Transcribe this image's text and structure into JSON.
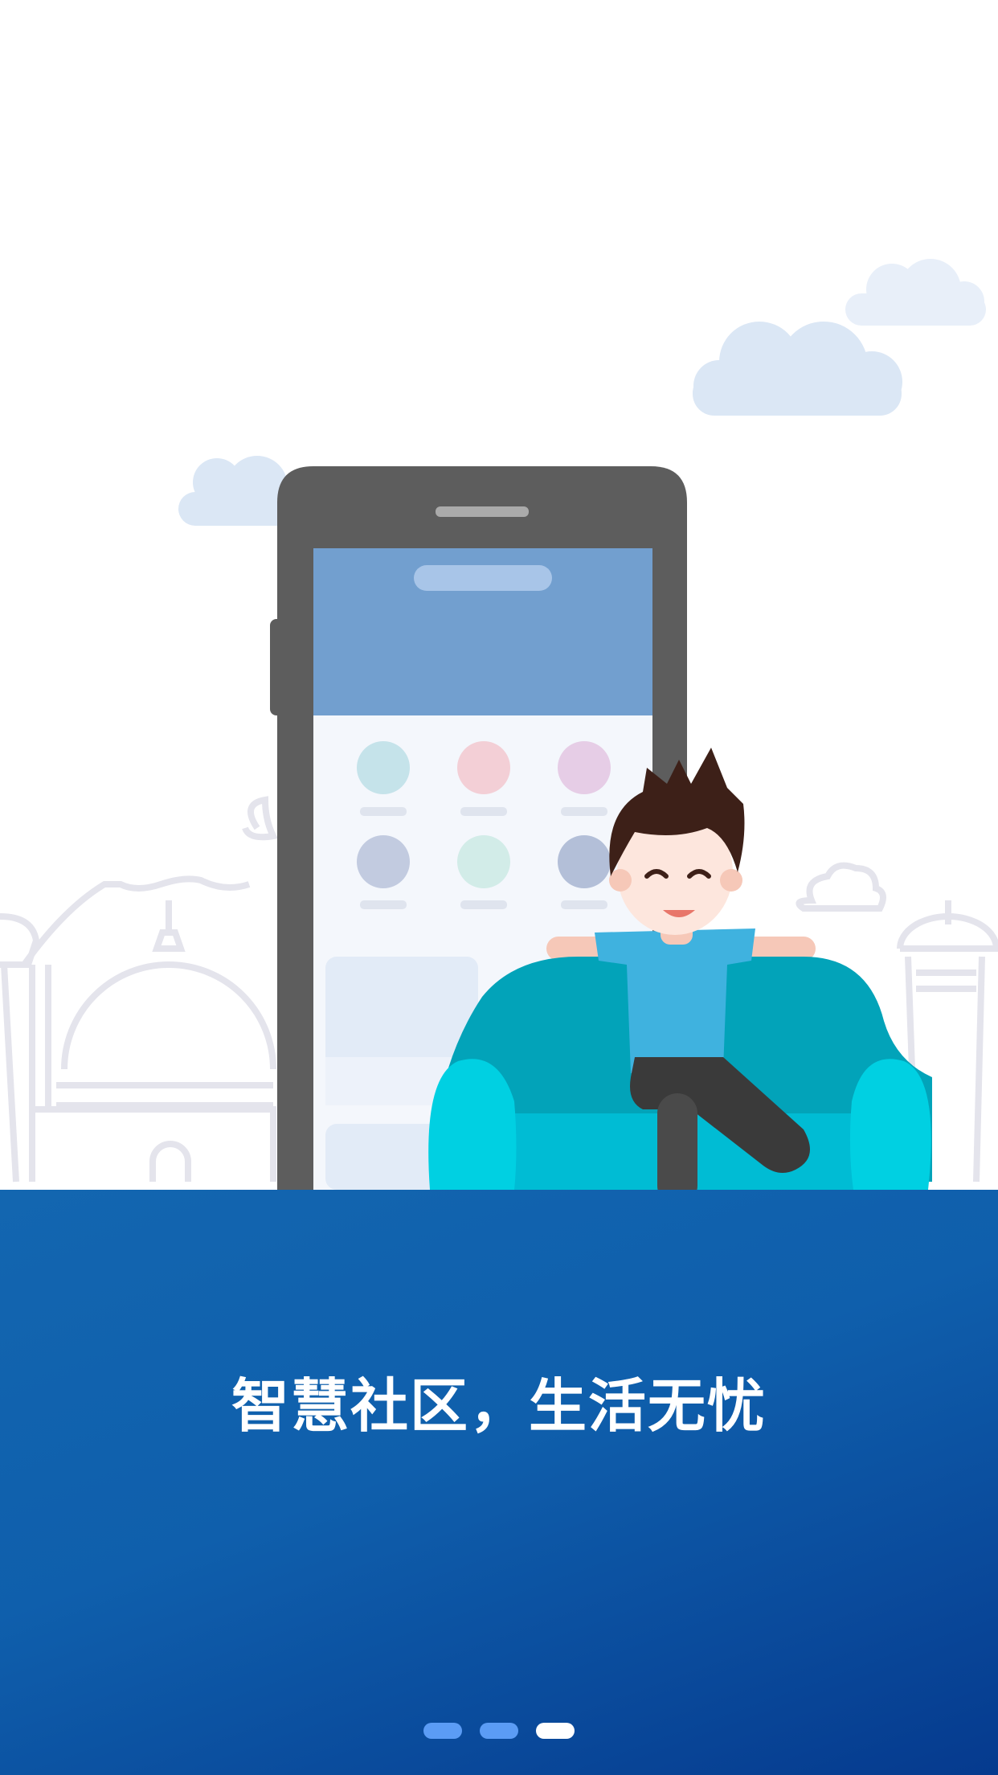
{
  "onboarding": {
    "slogan": "智慧社区，生活无忧",
    "page_indicator": {
      "total": 3,
      "current": 3,
      "active_color": "#ffffff",
      "inactive_color": "#5b9cf5"
    }
  },
  "colors": {
    "panel": "#0f5fac",
    "phone_body": "#5d5d5d",
    "phone_header": "#729fcf",
    "sofa": "#00b8d4",
    "shirt": "#3fb2df",
    "cloud": "#dbe7f5"
  }
}
